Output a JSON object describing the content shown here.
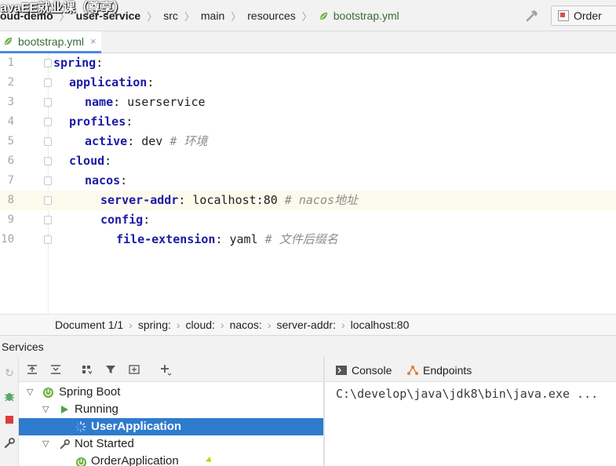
{
  "overlay": {
    "title": "avaEE就业课（尊享）"
  },
  "breadcrumb": {
    "items": [
      {
        "label": "oud-demo",
        "bold": true
      },
      {
        "label": "user-service",
        "bold": true
      },
      {
        "label": "src"
      },
      {
        "label": "main"
      },
      {
        "label": "resources"
      },
      {
        "label": "bootstrap.yml",
        "icon": "spring-leaf-icon"
      }
    ]
  },
  "toolbar": {
    "run_config_label": "Order",
    "build_icon": "hammer-icon"
  },
  "editor_tab": {
    "label": "bootstrap.yml",
    "close": "×"
  },
  "editor": {
    "current_line": 8,
    "lines": [
      {
        "num": "1",
        "key": "spring",
        "sep": ":",
        "value": "",
        "comment": ""
      },
      {
        "num": "2",
        "key": "application",
        "sep": ":",
        "value": "",
        "comment": ""
      },
      {
        "num": "3",
        "key": "name",
        "sep": ":",
        "value": " userservice",
        "comment": ""
      },
      {
        "num": "4",
        "key": "profiles",
        "sep": ":",
        "value": "",
        "comment": ""
      },
      {
        "num": "5",
        "key": "active",
        "sep": ":",
        "value": " dev",
        "comment": " # 环境"
      },
      {
        "num": "6",
        "key": "cloud",
        "sep": ":",
        "value": "",
        "comment": ""
      },
      {
        "num": "7",
        "key": "nacos",
        "sep": ":",
        "value": "",
        "comment": ""
      },
      {
        "num": "8",
        "key": "server-addr",
        "sep": ":",
        "value": " localhost:80",
        "comment": " # nacos地址"
      },
      {
        "num": "9",
        "key": "config",
        "sep": ":",
        "value": "",
        "comment": ""
      },
      {
        "num": "10",
        "key": "file-extension",
        "sep": ":",
        "value": " yaml",
        "comment": " # 文件后缀名"
      }
    ]
  },
  "editor_breadcrumb": {
    "items": [
      "Document 1/1",
      "spring:",
      "cloud:",
      "nacos:",
      "server-addr:",
      "localhost:80"
    ]
  },
  "services": {
    "title": "Services",
    "tree": [
      {
        "label": "Spring Boot",
        "icon": "spring-boot-icon",
        "expanded": true
      },
      {
        "label": "Running",
        "icon": "run-icon",
        "expanded": true
      },
      {
        "label": "UserApplication",
        "icon": "spinner-icon",
        "selected": true
      },
      {
        "label": "Not Started",
        "icon": "wrench-icon",
        "expanded": true
      },
      {
        "label": "OrderApplication",
        "icon": "spring-boot-icon"
      }
    ],
    "tabs": [
      {
        "label": "Console",
        "icon": "console-icon"
      },
      {
        "label": "Endpoints",
        "icon": "endpoints-icon"
      }
    ],
    "console_output": "C:\\develop\\java\\jdk8\\bin\\java.exe ..."
  },
  "colors": {
    "selection": "#2e7bcf",
    "yaml_key": "#1a1aa6",
    "comment": "#8c8c8c",
    "current_line": "#fcfaed",
    "spring_green": "#6db33f"
  }
}
